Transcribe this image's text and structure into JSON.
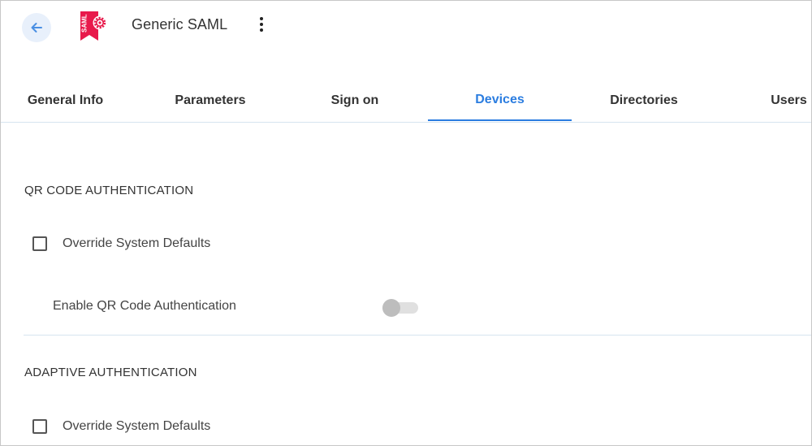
{
  "header": {
    "title": "Generic SAML",
    "logo_text": "SAML",
    "back_icon": "arrow-left-icon",
    "menu_icon": "more-vertical-icon"
  },
  "tabs": [
    {
      "label": "General Info",
      "active": false
    },
    {
      "label": "Parameters",
      "active": false
    },
    {
      "label": "Sign on",
      "active": false
    },
    {
      "label": "Devices",
      "active": true
    },
    {
      "label": "Directories",
      "active": false
    },
    {
      "label": "Users",
      "active": false
    }
  ],
  "sections": {
    "qr": {
      "title": "QR CODE AUTHENTICATION",
      "override_label": "Override System Defaults",
      "override_checked": false,
      "toggle_label": "Enable QR Code Authentication",
      "toggle_on": false
    },
    "adaptive": {
      "title": "ADAPTIVE AUTHENTICATION",
      "override_label": "Override System Defaults",
      "override_checked": false
    }
  },
  "colors": {
    "accent": "#2b7de0",
    "brand": "#e8194b",
    "back_button_bg": "#e8f0fb",
    "divider": "#d6e4f0"
  }
}
